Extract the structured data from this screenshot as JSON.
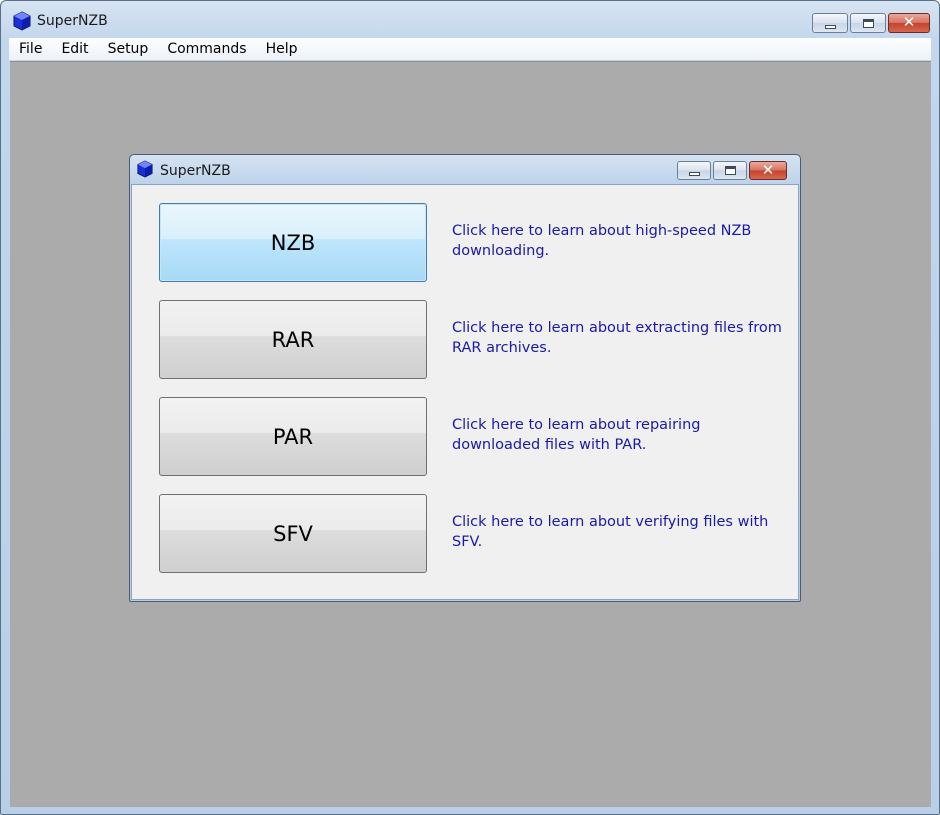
{
  "window": {
    "title": "SuperNZB",
    "icon": "blue-cube-app-icon",
    "close_glyph": "✕"
  },
  "menu": [
    "File",
    "Edit",
    "Setup",
    "Commands",
    "Help"
  ],
  "dialog": {
    "title": "SuperNZB",
    "icon": "blue-cube-app-icon",
    "close_glyph": "✕",
    "rows": [
      {
        "button": "NZB",
        "description": "Click here to learn about high-speed NZB downloading.",
        "focused": true
      },
      {
        "button": "RAR",
        "description": "Click here to learn about extracting files from RAR archives.",
        "focused": false
      },
      {
        "button": "PAR",
        "description": "Click here to learn about repairing downloaded files with PAR.",
        "focused": false
      },
      {
        "button": "SFV",
        "description": "Click here to learn about verifying files with SFV.",
        "focused": false
      }
    ]
  },
  "colors": {
    "link_text": "#1a1aa6",
    "mdi_background": "#ababab",
    "focused_button": "#bee6fd"
  }
}
